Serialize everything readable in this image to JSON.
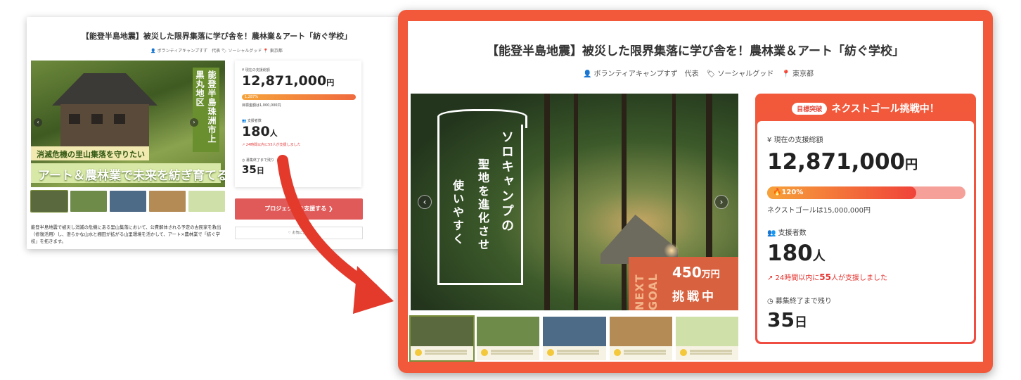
{
  "before": {
    "title": "【能登半島地震】被災した限界集落に学び舎を！農林業＆アート「紡ぐ学校」",
    "meta": "👤 ボランティアキャンプすず　代表 🏷 ソーシャルグッド 📍 東京都",
    "hero": {
      "vertical_text": "能登半島珠洲市上黒丸地区",
      "band1": "消滅危機の里山集落を守りたい",
      "band2": "アート＆農林業で未来を紡ぎ育てる",
      "prev_glyph": "‹",
      "next_glyph": "›"
    },
    "stats": {
      "raised_label": "¥ 現在の支援総額",
      "raised_amount": "12,871,000",
      "currency": "円",
      "progress_text": "1,287%",
      "goal_text": "目標金額は1,000,000円",
      "backers_label": "👥 支援者数",
      "backers_count": "180",
      "backers_unit": "人",
      "recent_text": "↗ 24時間以内に55人が支援しました",
      "remaining_label": "◷ 募集終了まで残り",
      "remaining_days": "35",
      "remaining_unit": "日"
    },
    "cta_label": "プロジェクトを支援する ❯",
    "favorite_label": "♡ お気に入り",
    "description": "能登半島地震で被災し消滅の危機にある里山集落において、公費解体される予定の古民家を救出（修復活用）し、澄らかな山水と棚田が拡がる山里環境を活かして、アート×農林業で「紡ぐ学校」を拓きます。"
  },
  "after": {
    "title": "【能登半島地震】被災した限界集落に学び舎を！農林業＆アート「紡ぐ学校」",
    "owner_icon": "👤",
    "owner": "ボランティアキャンプすず　代表",
    "category_icon": "🏷",
    "category": "ソーシャルグッド",
    "location_icon": "📍",
    "location": "東京都",
    "hero": {
      "sign_line1": "ソロキャンプの",
      "sign_line2": "聖地を進化させ",
      "sign_line3": "使いやすく",
      "badge_next": "NEXT GOAL",
      "badge_amount": "450",
      "badge_unit": "万円",
      "badge_challenge": "挑戦中",
      "prev_glyph": "‹",
      "next_glyph": "›"
    },
    "panel": {
      "pill": "目標突破",
      "header": "ネクストゴール挑戦中！",
      "raised_label": "¥  現在の支援総額",
      "raised_amount": "12,871,000",
      "currency": "円",
      "progress_text": "🔥120%",
      "progress_fraction": 0.75,
      "goal_text": "ネクストゴールは15,000,000円",
      "backers_label": "👥  支援者数",
      "backers_count": "180",
      "backers_unit": "人",
      "recent_prefix": "↗  24時間以内に",
      "recent_count": "55",
      "recent_suffix": "人が支援しました",
      "remaining_label": "◷  募集終了まで残り",
      "remaining_days": "35",
      "remaining_unit": "日"
    }
  },
  "colors": {
    "frame": "#f2593a",
    "accent_red": "#e05a5a",
    "progress_start": "#f6a23a",
    "progress_end": "#f0433a"
  }
}
